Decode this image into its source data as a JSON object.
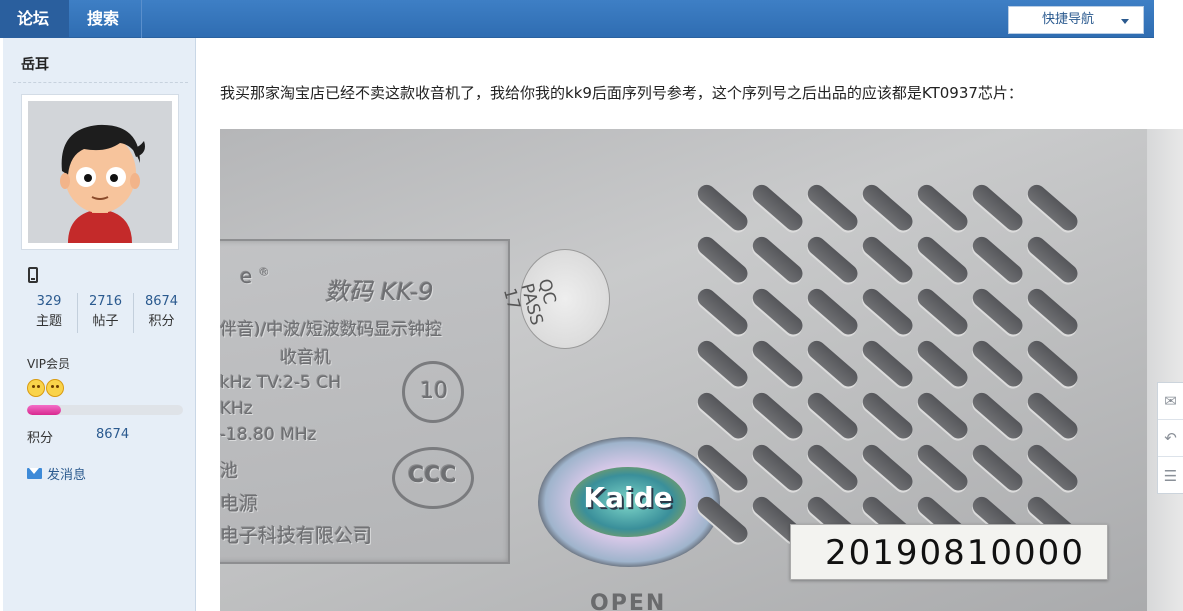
{
  "topbar": {
    "tabs": [
      {
        "label": "论坛",
        "active": true
      },
      {
        "label": "搜索",
        "active": false
      }
    ],
    "quicknav_label": "快捷导航"
  },
  "sidebar": {
    "username": "岳耳",
    "stats": [
      {
        "value": "329",
        "label": "主题"
      },
      {
        "value": "2716",
        "label": "帖子"
      },
      {
        "value": "8674",
        "label": "积分"
      }
    ],
    "group": "VIP会员",
    "progress_fraction": 0.22,
    "score_label": "积分",
    "score_value": "8674",
    "message_label": "发消息"
  },
  "post": {
    "text": "我买那家淘宝店已经不卖这款收音机了，我给你我的kk9后面序列号参考，这个序列号之后出品的应该都是KT0937芯片："
  },
  "photo": {
    "model": "数码 KK-9",
    "line_a": "伴音)/中波/短波数码显示钟控",
    "line_b": "收音机",
    "line_c": "kHz    TV:2-5 CH",
    "line_d": "KHz",
    "line_e": "-18.80 MHz",
    "line_f": "池",
    "line_g": "电源",
    "line_h": "电子科技有限公司",
    "qc": "QC\nPASS\n17",
    "brand": "Kaide",
    "serial": "20190810000",
    "bottom": "OPEN"
  },
  "colors": {
    "accent": "#2f6db2",
    "link": "#2b5a8f",
    "sidebar_bg": "#e6eef7",
    "progress": "#e0379f"
  },
  "icons": {
    "float_1": "comment-icon",
    "float_2": "back-icon",
    "float_3": "list-icon"
  }
}
